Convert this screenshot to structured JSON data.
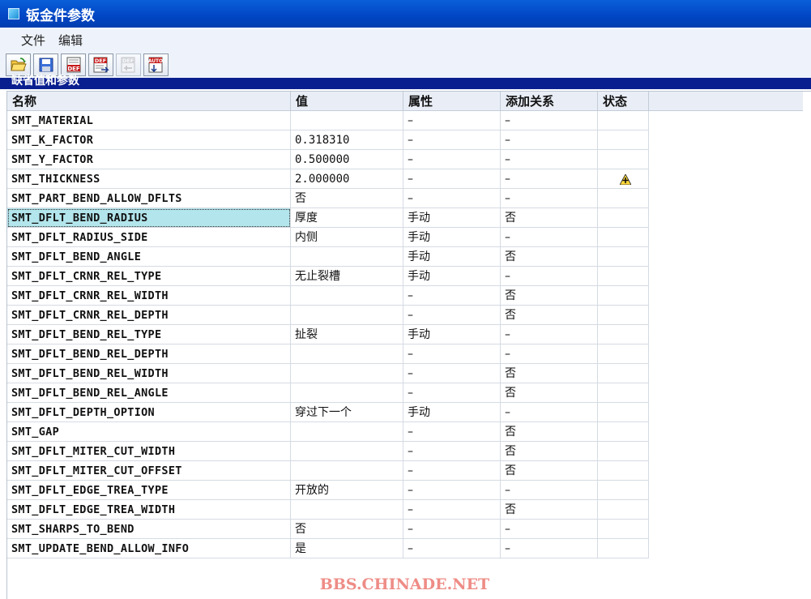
{
  "window": {
    "title": "钣金件参数",
    "app_icon": "window-app-icon"
  },
  "menu": {
    "items": [
      {
        "label": "文件"
      },
      {
        "label": "编辑"
      }
    ]
  },
  "toolbar": {
    "buttons": [
      {
        "name": "open-folder-icon",
        "disabled": false
      },
      {
        "name": "save-icon",
        "disabled": false
      },
      {
        "name": "def-icon",
        "label": "DEF",
        "disabled": false
      },
      {
        "name": "def-export-icon",
        "label": "DEF",
        "disabled": false
      },
      {
        "name": "def-import-icon",
        "label": "DEF",
        "disabled": true
      },
      {
        "name": "auto-icon",
        "label": "AUTO",
        "disabled": false
      }
    ]
  },
  "section": {
    "title": "缺省值和参数"
  },
  "table": {
    "columns": [
      "名称",
      "值",
      "属性",
      "添加关系",
      "状态"
    ],
    "selected_row": 5,
    "rows": [
      {
        "name": "SMT_MATERIAL",
        "value": "",
        "attr": "–",
        "relation": "–",
        "status": ""
      },
      {
        "name": "SMT_K_FACTOR",
        "value": "0.318310",
        "attr": "–",
        "relation": "–",
        "status": ""
      },
      {
        "name": "SMT_Y_FACTOR",
        "value": "0.500000",
        "attr": "–",
        "relation": "–",
        "status": ""
      },
      {
        "name": "SMT_THICKNESS",
        "value": "2.000000",
        "attr": "–",
        "relation": "–",
        "status": "warning-plus-icon"
      },
      {
        "name": "SMT_PART_BEND_ALLOW_DFLTS",
        "value": "否",
        "attr": "–",
        "relation": "–",
        "status": ""
      },
      {
        "name": "SMT_DFLT_BEND_RADIUS",
        "value": "厚度",
        "attr": "手动",
        "relation": "否",
        "status": ""
      },
      {
        "name": "SMT_DFLT_RADIUS_SIDE",
        "value": "内侧",
        "attr": "手动",
        "relation": "–",
        "status": ""
      },
      {
        "name": "SMT_DFLT_BEND_ANGLE",
        "value": "",
        "attr": "手动",
        "relation": "否",
        "status": ""
      },
      {
        "name": "SMT_DFLT_CRNR_REL_TYPE",
        "value": "无止裂槽",
        "attr": "手动",
        "relation": "–",
        "status": ""
      },
      {
        "name": "SMT_DFLT_CRNR_REL_WIDTH",
        "value": "",
        "attr": "–",
        "relation": "否",
        "status": ""
      },
      {
        "name": "SMT_DFLT_CRNR_REL_DEPTH",
        "value": "",
        "attr": "–",
        "relation": "否",
        "status": ""
      },
      {
        "name": "SMT_DFLT_BEND_REL_TYPE",
        "value": "扯裂",
        "attr": "手动",
        "relation": "–",
        "status": ""
      },
      {
        "name": "SMT_DFLT_BEND_REL_DEPTH",
        "value": "",
        "attr": "–",
        "relation": "–",
        "status": ""
      },
      {
        "name": "SMT_DFLT_BEND_REL_WIDTH",
        "value": "",
        "attr": "–",
        "relation": "否",
        "status": ""
      },
      {
        "name": "SMT_DFLT_BEND_REL_ANGLE",
        "value": "",
        "attr": "–",
        "relation": "否",
        "status": ""
      },
      {
        "name": "SMT_DFLT_DEPTH_OPTION",
        "value": "穿过下一个",
        "attr": "手动",
        "relation": "–",
        "status": ""
      },
      {
        "name": "SMT_GAP",
        "value": "",
        "attr": "–",
        "relation": "否",
        "status": ""
      },
      {
        "name": "SMT_DFLT_MITER_CUT_WIDTH",
        "value": "",
        "attr": "–",
        "relation": "否",
        "status": ""
      },
      {
        "name": "SMT_DFLT_MITER_CUT_OFFSET",
        "value": "",
        "attr": "–",
        "relation": "否",
        "status": ""
      },
      {
        "name": "SMT_DFLT_EDGE_TREA_TYPE",
        "value": "开放的",
        "attr": "–",
        "relation": "–",
        "status": ""
      },
      {
        "name": "SMT_DFLT_EDGE_TREA_WIDTH",
        "value": "",
        "attr": "–",
        "relation": "否",
        "status": ""
      },
      {
        "name": "SMT_SHARPS_TO_BEND",
        "value": "否",
        "attr": "–",
        "relation": "–",
        "status": ""
      },
      {
        "name": "SMT_UPDATE_BEND_ALLOW_INFO",
        "value": "是",
        "attr": "–",
        "relation": "–",
        "status": ""
      }
    ]
  },
  "watermark": {
    "text": "BBS.CHINADE.NET"
  },
  "colors": {
    "titlebar": "#0147c6",
    "section_bar": "#0a1f8f",
    "selected_cell": "#b3e5ec",
    "watermark": "#ee8c86"
  }
}
